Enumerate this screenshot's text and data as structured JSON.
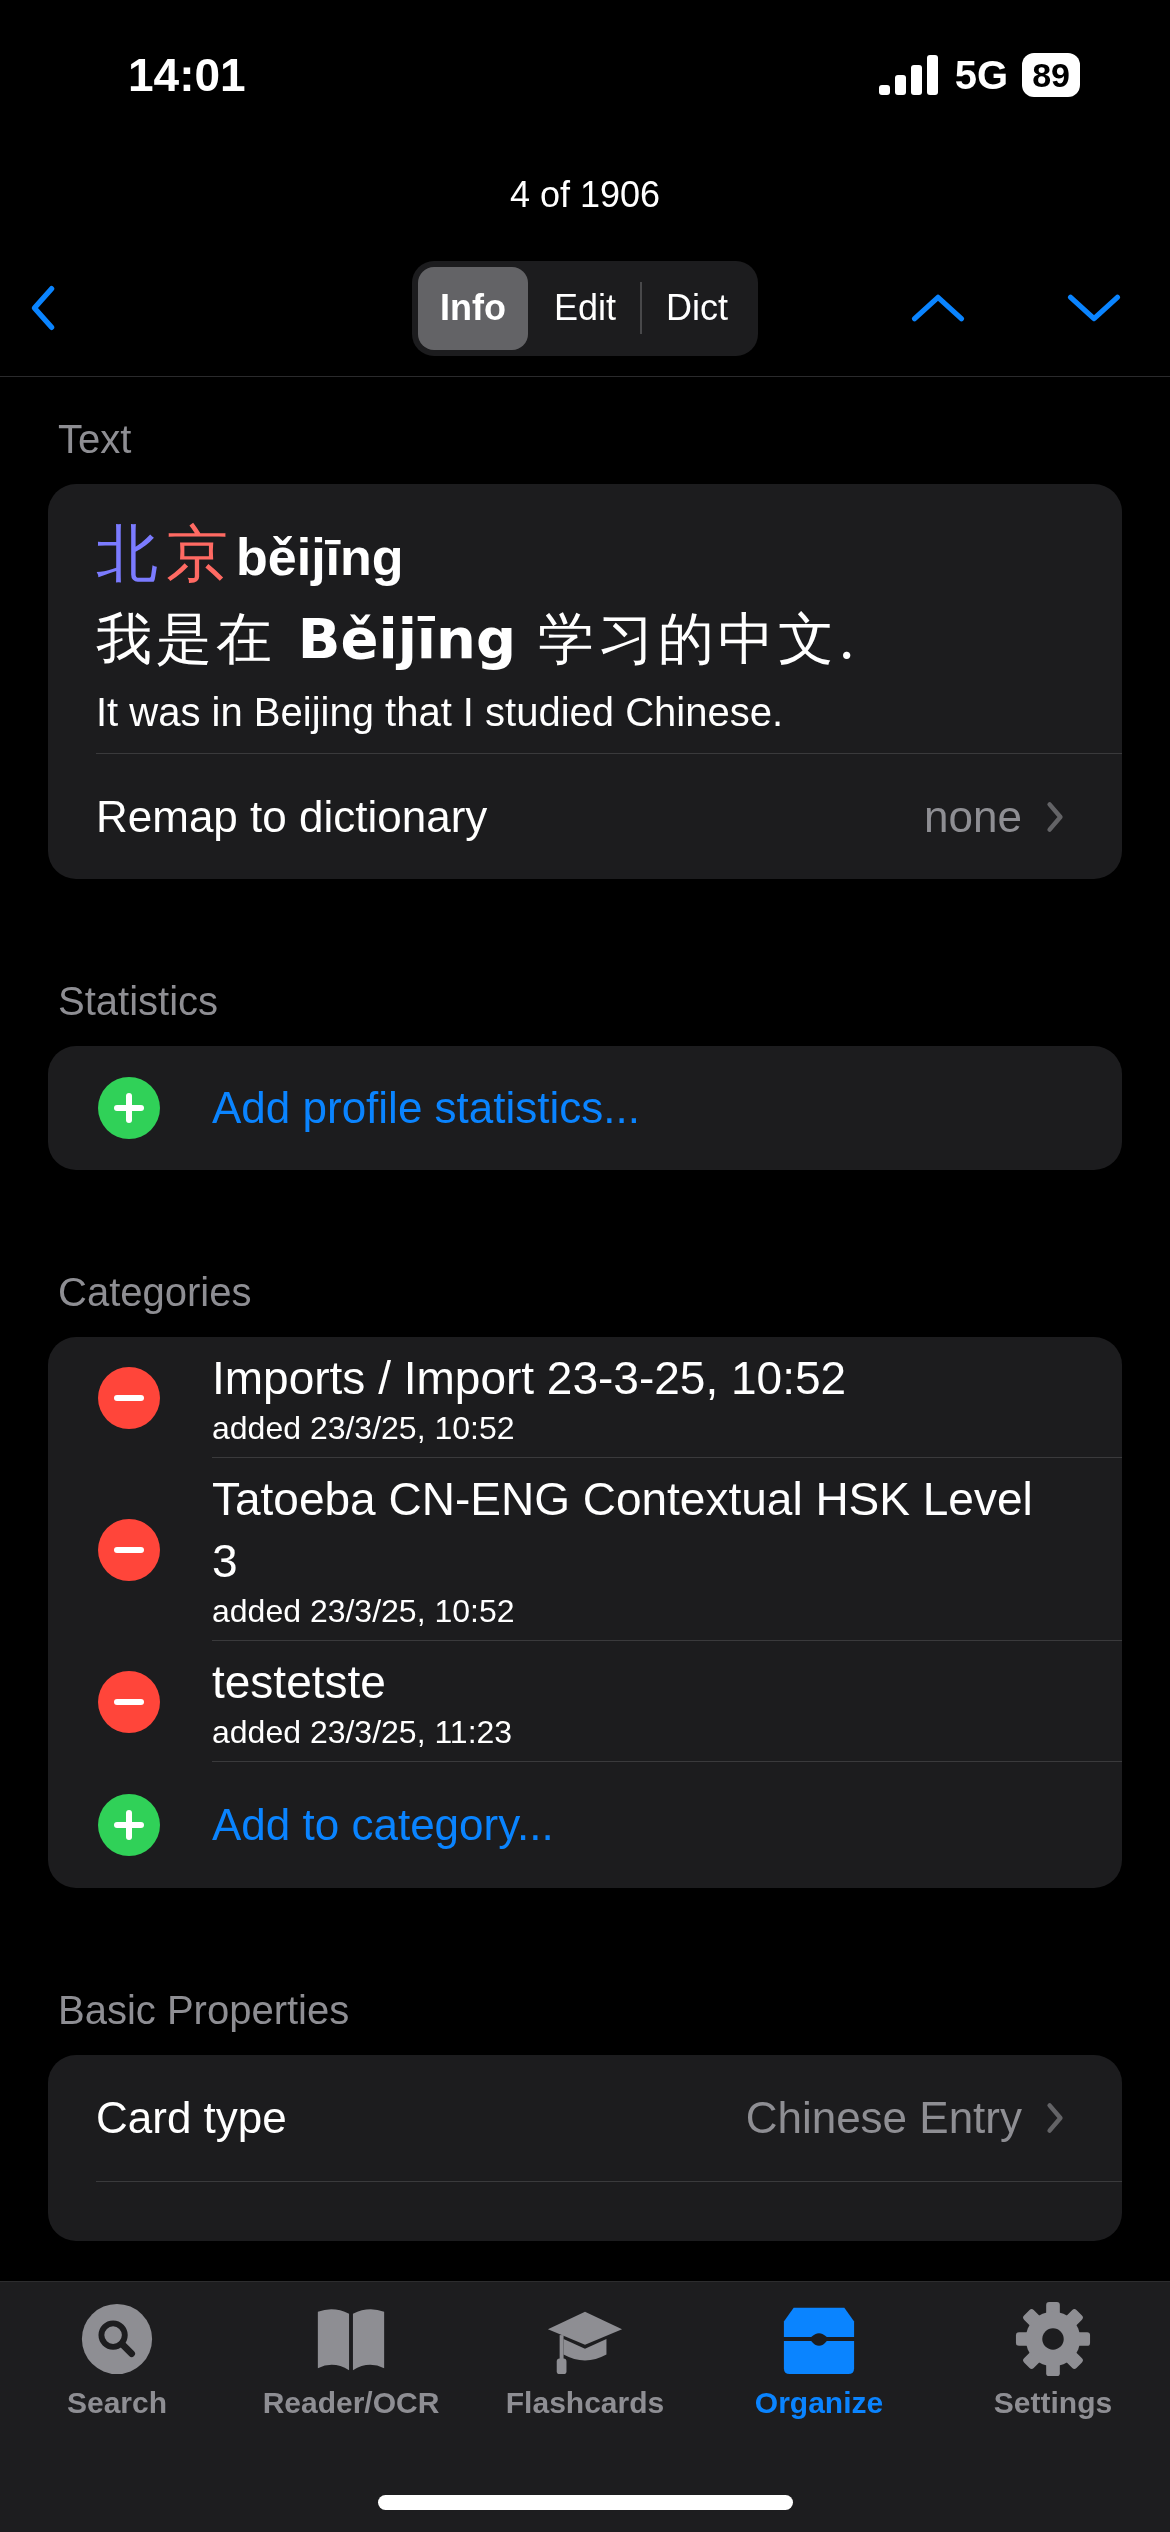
{
  "status_bar": {
    "time": "14:01",
    "network": "5G",
    "battery": "89"
  },
  "nav": {
    "title": "4 of 1906",
    "segments": [
      {
        "label": "Info",
        "selected": true
      },
      {
        "label": "Edit",
        "selected": false
      },
      {
        "label": "Dict",
        "selected": false
      }
    ]
  },
  "text_section": {
    "header": "Text",
    "headword": [
      {
        "char": "北",
        "color": "#7b7bff"
      },
      {
        "char": "京",
        "color": "#ff6a63"
      }
    ],
    "pinyin": "běijīng",
    "sentence": "我是在 **Běijīng** 学习的中文.",
    "translation": "It was in Beijing that I studied Chinese.",
    "remap": {
      "label": "Remap to dictionary",
      "value": "none"
    }
  },
  "statistics": {
    "header": "Statistics",
    "rows": [
      {
        "kind": "add",
        "label": "Add profile statistics..."
      }
    ]
  },
  "categories": {
    "header": "Categories",
    "rows": [
      {
        "kind": "remove",
        "label": "Imports / Import 23-3-25, 10:52",
        "detail": "added 23/3/25, 10:52"
      },
      {
        "kind": "remove",
        "label": "Tatoeba CN-ENG Contextual HSK Level 3",
        "detail": "added 23/3/25, 10:52"
      },
      {
        "kind": "remove",
        "label": "testetste",
        "detail": "added 23/3/25, 11:23"
      },
      {
        "kind": "add",
        "label": "Add to category..."
      }
    ]
  },
  "basic_properties": {
    "header": "Basic Properties",
    "rows": [
      {
        "label": "Card type",
        "value": "Chinese Entry"
      }
    ]
  },
  "tab_bar": [
    {
      "kind": "search",
      "label": "Search",
      "selected": false
    },
    {
      "kind": "book",
      "label": "Reader/OCR",
      "selected": false
    },
    {
      "kind": "cap",
      "label": "Flashcards",
      "selected": false
    },
    {
      "kind": "tray",
      "label": "Organize",
      "selected": true
    },
    {
      "kind": "gear",
      "label": "Settings",
      "selected": false
    }
  ]
}
